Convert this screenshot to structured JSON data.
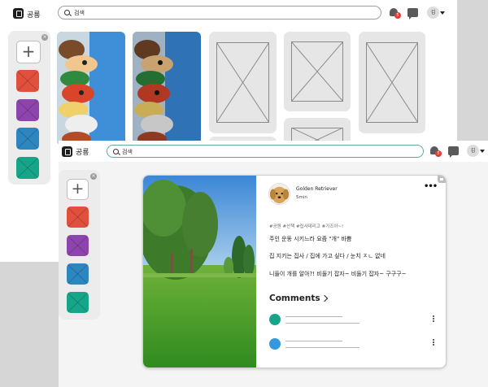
{
  "app": {
    "name": "공룡"
  },
  "search": {
    "placeholder": "검색"
  },
  "notifications": {
    "count": "5"
  },
  "user": {
    "avatar_initial": "김"
  },
  "palette": {
    "close_glyph": "×",
    "add_glyph": "+",
    "swatches": [
      {
        "name": "red",
        "color": "#e0503d"
      },
      {
        "name": "purple",
        "color": "#8e44ad"
      },
      {
        "name": "blue",
        "color": "#2e86c1"
      },
      {
        "name": "teal",
        "color": "#17a589"
      }
    ]
  },
  "post": {
    "author": "Golden Retriever",
    "time_ago": "5min",
    "more_glyph": "•••",
    "tags": "#공원  #산책  #집사데리고  #가즈아~!",
    "lines": [
      "주인 운동 시키느라 요즘 \"개\" 바쁨",
      "집 지키는 집사 / 집에 가고 싶다 / 눈치 ㅈㄴ 없네",
      "니들이 개를 알아?! 비둘기 잡자~ 비둘기 잡자~ 구구구~"
    ],
    "comments_label": "Comments",
    "comment_colors": [
      "#17a589",
      "#3498db"
    ]
  }
}
